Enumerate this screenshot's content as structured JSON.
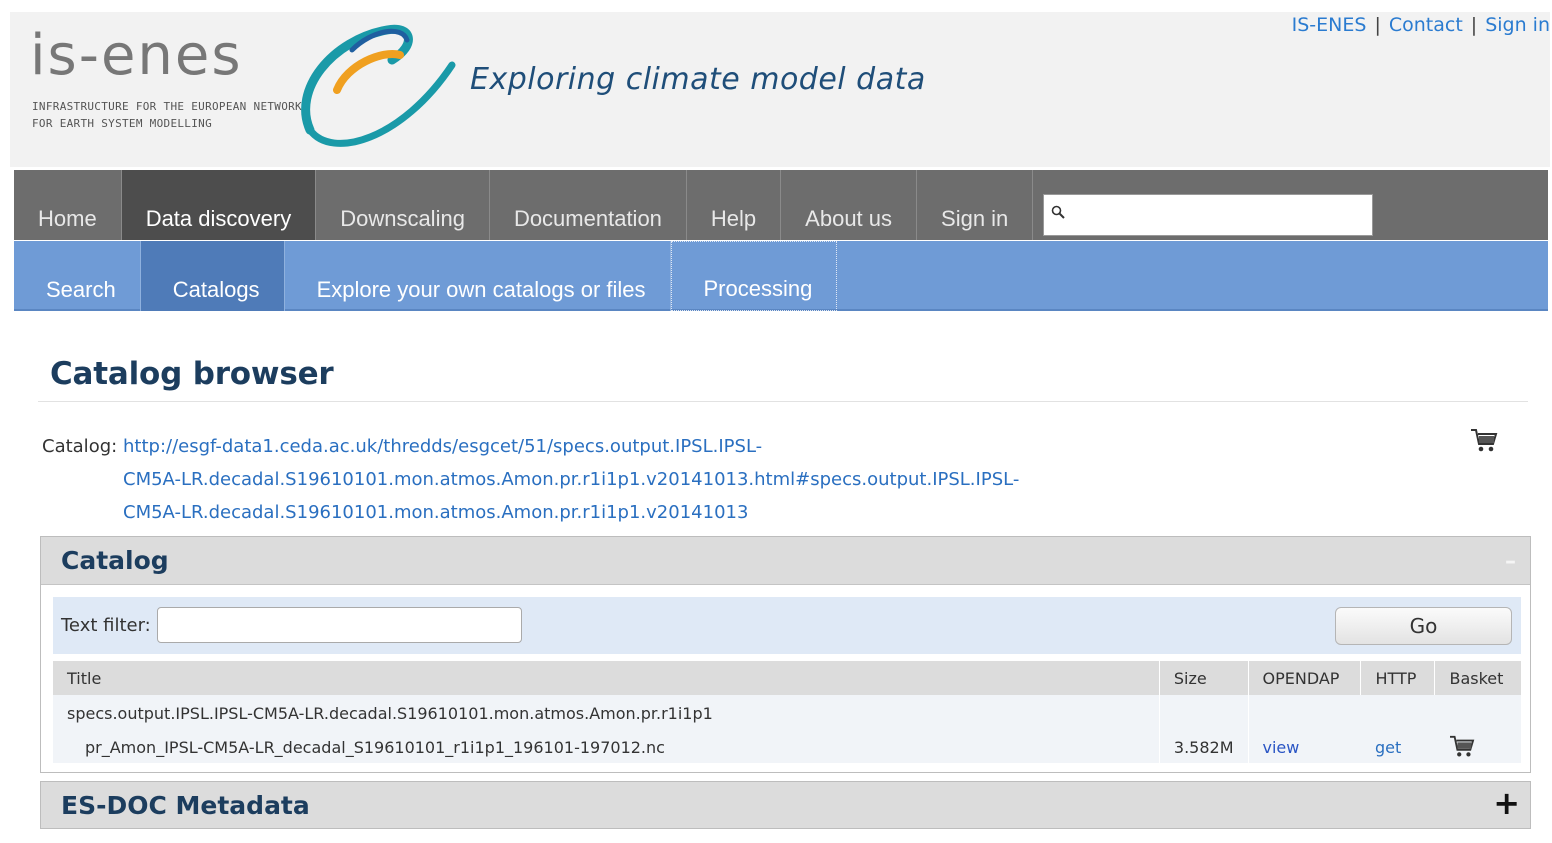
{
  "header": {
    "logo_word": "is-enes",
    "logo_sub": "INFRASTRUCTURE FOR THE EUROPEAN NETWORK\nFOR EARTH SYSTEM MODELLING",
    "tagline": "Exploring climate model data",
    "toplinks": [
      "IS-ENES",
      "Contact",
      "Sign in"
    ]
  },
  "mainnav": {
    "items": [
      "Home",
      "Data discovery",
      "Downscaling",
      "Documentation",
      "Help",
      "About us",
      "Sign in"
    ],
    "active": "Data discovery",
    "search_icon": "magnifier-icon"
  },
  "subnav": {
    "items": [
      "Search",
      "Catalogs",
      "Explore your own catalogs or files",
      "Processing"
    ],
    "active": "Catalogs"
  },
  "content": {
    "title": "Catalog browser",
    "catalog_label": "Catalog:",
    "catalog_url_lines": [
      "http://esgf-data1.ceda.ac.uk/thredds/esgcet/51/specs.output.IPSL.IPSL-",
      "CM5A-LR.decadal.S19610101.mon.atmos.Amon.pr.r1i1p1.v20141013.html#specs.output.IPSL.IPSL-",
      "CM5A-LR.decadal.S19610101.mon.atmos.Amon.pr.r1i1p1.v20141013"
    ],
    "basket_icon": "cart-icon"
  },
  "catalog_panel": {
    "title": "Catalog",
    "toggle": "–",
    "filter_label": "Text filter:",
    "go_label": "Go",
    "columns": [
      "Title",
      "Size",
      "OPENDAP",
      "HTTP",
      "Basket"
    ],
    "dataset_title": "specs.output.IPSL.IPSL-CM5A-LR.decadal.S19610101.mon.atmos.Amon.pr.r1i1p1",
    "file": {
      "name": "pr_Amon_IPSL-CM5A-LR_decadal_S19610101_r1i1p1_196101-197012.nc",
      "size": "3.582M",
      "opendap": "view",
      "http": "get"
    }
  },
  "esdoc_panel": {
    "title": "ES-DOC Metadata",
    "toggle": "+"
  },
  "colors": {
    "nav_gray": "#6d6d6d",
    "subnav_blue": "#6f9bd6",
    "title_navy": "#1c3d5e",
    "link_blue": "#2a6fc0"
  }
}
